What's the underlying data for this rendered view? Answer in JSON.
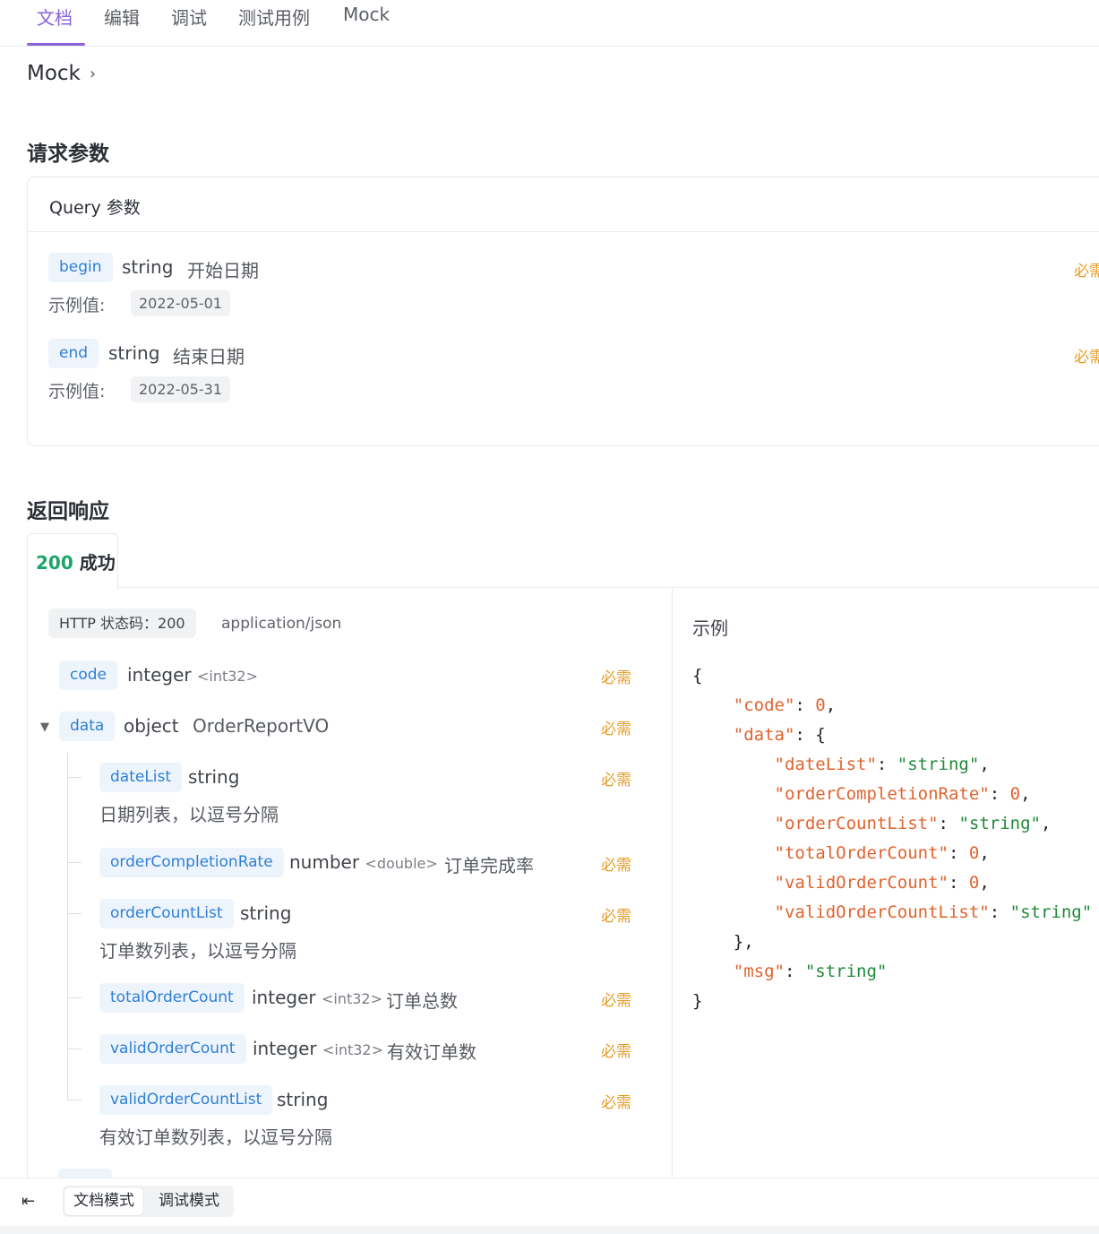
{
  "tabs": [
    "文档",
    "编辑",
    "调试",
    "测试用例",
    "Mock"
  ],
  "breadcrumb": "Mock",
  "request_section_title": "请求参数",
  "query_card_title": "Query 参数",
  "query_params": [
    {
      "name": "begin",
      "type": "string",
      "desc": "开始日期",
      "example_label": "示例值:",
      "example": "2022-05-01",
      "required": "必需"
    },
    {
      "name": "end",
      "type": "string",
      "desc": "结束日期",
      "example_label": "示例值:",
      "example": "2022-05-31",
      "required": "必需"
    }
  ],
  "response_section_title": "返回响应",
  "response_tab": {
    "code": "200",
    "label": "成功"
  },
  "status_chip": "HTTP 状态码：200",
  "content_type": "application/json",
  "fields": [
    {
      "name": "code",
      "type": "integer",
      "format": "<int32>",
      "desc": "",
      "required": "必需"
    },
    {
      "name": "data",
      "type": "object",
      "format": "",
      "desc": "OrderReportVO",
      "required": "必需"
    },
    {
      "name": "dateList",
      "type": "string",
      "format": "",
      "desc": "日期列表，以逗号分隔",
      "required": "必需"
    },
    {
      "name": "orderCompletionRate",
      "type": "number",
      "format": "<double>",
      "desc": "订单完成率",
      "required": "必需"
    },
    {
      "name": "orderCountList",
      "type": "string",
      "format": "",
      "desc": "订单数列表，以逗号分隔",
      "required": "必需"
    },
    {
      "name": "totalOrderCount",
      "type": "integer",
      "format": "<int32>",
      "desc": "订单总数",
      "required": "必需"
    },
    {
      "name": "validOrderCount",
      "type": "integer",
      "format": "<int32>",
      "desc": "有效订单数",
      "required": "必需"
    },
    {
      "name": "validOrderCountList",
      "type": "string",
      "format": "",
      "desc": "有效订单数列表，以逗号分隔",
      "required": "必需"
    }
  ],
  "example_title": "示例",
  "example_json": {
    "code_key": "\"code\"",
    "code_val": "0",
    "data_key": "\"data\"",
    "dateList_key": "\"dateList\"",
    "dateList_val": "\"string\"",
    "ocr_key": "\"orderCompletionRate\"",
    "ocr_val": "0",
    "ocl_key": "\"orderCountList\"",
    "ocl_val": "\"string\"",
    "toc_key": "\"totalOrderCount\"",
    "toc_val": "0",
    "voc_key": "\"validOrderCount\"",
    "voc_val": "0",
    "vocl_key": "\"validOrderCountList\"",
    "vocl_val": "\"string\"",
    "msg_key": "\"msg\"",
    "msg_val": "\"string\""
  },
  "bottom": {
    "collapse_icon": "collapse-left-icon",
    "mode_doc": "文档模式",
    "mode_debug": "调试模式"
  },
  "colors": {
    "accent": "#8b63d8",
    "success": "#1ca46b",
    "required": "#e69a21",
    "param": "#2e7fd6",
    "json_key": "#e0632e",
    "json_string": "#1f8a3a"
  }
}
